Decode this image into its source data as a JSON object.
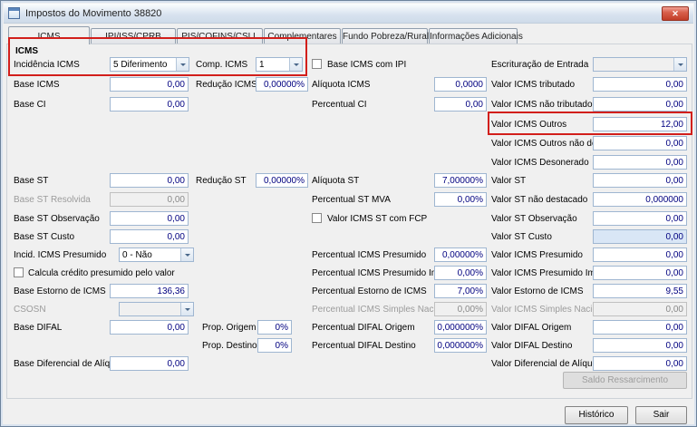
{
  "window": {
    "title": "Impostos do Movimento 38820",
    "close_glyph": "✕"
  },
  "tabs": [
    "ICMS",
    "IPI/ISS/CPRB",
    "PIS/COFINS/CSLL",
    "Complementares",
    "Fundo Pobreza/Rural",
    "Informações Adicionais"
  ],
  "active_tab": "ICMS",
  "group_title": "ICMS",
  "colors": {
    "annotation_red": "#d21f1b",
    "value_blue": "#000080",
    "window_bg": "#f0f0f0",
    "focus_field_bg": "#d9e6f6"
  },
  "fields": {
    "incidencia_icms": {
      "label": "Incidência ICMS",
      "value": "5 Diferimento"
    },
    "comp_icms": {
      "label": "Comp. ICMS",
      "value": "1"
    },
    "base_icms_com_ipi": {
      "label": "Base ICMS com IPI",
      "checked": false
    },
    "escrituracao_entrada": {
      "label": "Escrituração de Entrada",
      "value": ""
    },
    "base_icms": {
      "label": "Base ICMS",
      "value": "0,00"
    },
    "reducao_icms": {
      "label": "Redução ICMS",
      "value": "0,00000%"
    },
    "aliquota_icms": {
      "label": "Alíquota ICMS",
      "value": "0,0000"
    },
    "valor_icms_tributado": {
      "label": "Valor ICMS tributado",
      "value": "0,00"
    },
    "base_ci": {
      "label": "Base CI",
      "value": "0,00"
    },
    "percentual_ci": {
      "label": "Percentual CI",
      "value": "0,00"
    },
    "valor_icms_nao_tributado": {
      "label": "Valor ICMS não tributado",
      "value": "0,00"
    },
    "valor_icms_outros": {
      "label": "Valor ICMS Outros",
      "value": "12,00"
    },
    "valor_icms_outros_nao_dest": {
      "label": "Valor ICMS Outros não dest.",
      "value": "0,00"
    },
    "valor_icms_desonerado": {
      "label": "Valor ICMS Desonerado",
      "value": "0,00"
    },
    "base_st": {
      "label": "Base ST",
      "value": "0,00"
    },
    "reducao_st": {
      "label": "Redução ST",
      "value": "0,00000%"
    },
    "aliquota_st": {
      "label": "Alíquota ST",
      "value": "7,00000%"
    },
    "valor_st": {
      "label": "Valor ST",
      "value": "0,00"
    },
    "base_st_resolvida": {
      "label": "Base ST Resolvida",
      "value": "0,00"
    },
    "percentual_st_mva": {
      "label": "Percentual ST MVA",
      "value": "0,00%"
    },
    "valor_st_nao_destacado": {
      "label": "Valor ST não destacado",
      "value": "0,000000"
    },
    "base_st_observacao": {
      "label": "Base ST Observação",
      "value": "0,00"
    },
    "valor_icms_st_com_fcp": {
      "label": "Valor ICMS ST com FCP",
      "checked": false
    },
    "valor_st_observacao": {
      "label": "Valor ST Observação",
      "value": "0,00"
    },
    "base_st_custo": {
      "label": "Base ST Custo",
      "value": "0,00"
    },
    "valor_st_custo": {
      "label": "Valor ST Custo",
      "value": "0,00"
    },
    "incid_icms_presumido": {
      "label": "Incid. ICMS Presumido",
      "value": "0 - Não"
    },
    "percentual_icms_presumido": {
      "label": "Percentual ICMS Presumido",
      "value": "0,00000%"
    },
    "valor_icms_presumido": {
      "label": "Valor ICMS Presumido",
      "value": "0,00"
    },
    "calcula_credito_presumido": {
      "label": "Calcula crédito presumido pelo valor",
      "checked": false
    },
    "percentual_icms_presumido_imp_pr": {
      "label": "Percentual ICMS Presumido Imp. PR",
      "value": "0,00%"
    },
    "valor_icms_presumido_imp_pr": {
      "label": "Valor ICMS Presumido Imp. PR",
      "value": "0,00"
    },
    "base_estorno_icms": {
      "label": "Base Estorno de ICMS",
      "value": "136,36"
    },
    "percentual_estorno_icms": {
      "label": "Percentual Estorno de ICMS",
      "value": "7,00%"
    },
    "valor_estorno_icms": {
      "label": "Valor Estorno de ICMS",
      "value": "9,55"
    },
    "csosn": {
      "label": "CSOSN",
      "value": ""
    },
    "percentual_icms_simples": {
      "label": "Percentual ICMS Simples Nacional",
      "value": "0,00%"
    },
    "valor_icms_simples": {
      "label": "Valor ICMS Simples Nacional",
      "value": "0,00"
    },
    "base_difal": {
      "label": "Base DIFAL",
      "value": "0,00"
    },
    "prop_origem": {
      "label": "Prop. Origem",
      "value": "0%"
    },
    "percentual_difal_origem": {
      "label": "Percentual DIFAL Origem",
      "value": "0,000000%"
    },
    "valor_difal_origem": {
      "label": "Valor DIFAL Origem",
      "value": "0,00"
    },
    "prop_destino": {
      "label": "Prop. Destino",
      "value": "0%"
    },
    "percentual_difal_destino": {
      "label": "Percentual DIFAL Destino",
      "value": "0,000000%"
    },
    "valor_difal_destino": {
      "label": "Valor DIFAL Destino",
      "value": "0,00"
    },
    "base_diferencial_aliq": {
      "label": "Base Diferencial de Alíq.",
      "value": "0,00"
    },
    "valor_diferencial_aliquota": {
      "label": "Valor Diferencial de Alíquota",
      "value": "0,00"
    }
  },
  "buttons": {
    "saldo_ressarcimento": "Saldo Ressarcimento",
    "historico": "Histórico",
    "sair": "Sair"
  }
}
